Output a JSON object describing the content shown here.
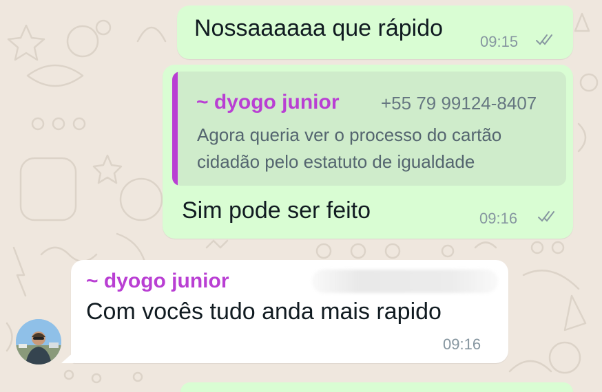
{
  "messages": [
    {
      "direction": "outgoing",
      "text": "Nossaaaaaa que rápido",
      "time": "09:15",
      "status_icon": "double-check-icon"
    },
    {
      "direction": "outgoing",
      "quoted": {
        "author": "~ dyogo junior",
        "phone": "+55 79 99124-8407",
        "line1": "Agora queria ver o processo do cartão",
        "line2": "cidadão pelo estatuto de igualdade"
      },
      "text": "Sim pode ser feito",
      "time": "09:16",
      "status_icon": "double-check-icon"
    },
    {
      "direction": "incoming",
      "author": "~ dyogo junior",
      "text": "Com vocês tudo anda mais rapido",
      "time": "09:16",
      "avatar_icon": "contact-photo-avatar"
    }
  ],
  "colors": {
    "chat_background": "#efe7de",
    "outgoing_bubble": "#d9fdd3",
    "quote_background": "#cfeccb",
    "incoming_bubble": "#ffffff",
    "author_accent": "#b93fd3",
    "timestamp": "#8696a0"
  }
}
